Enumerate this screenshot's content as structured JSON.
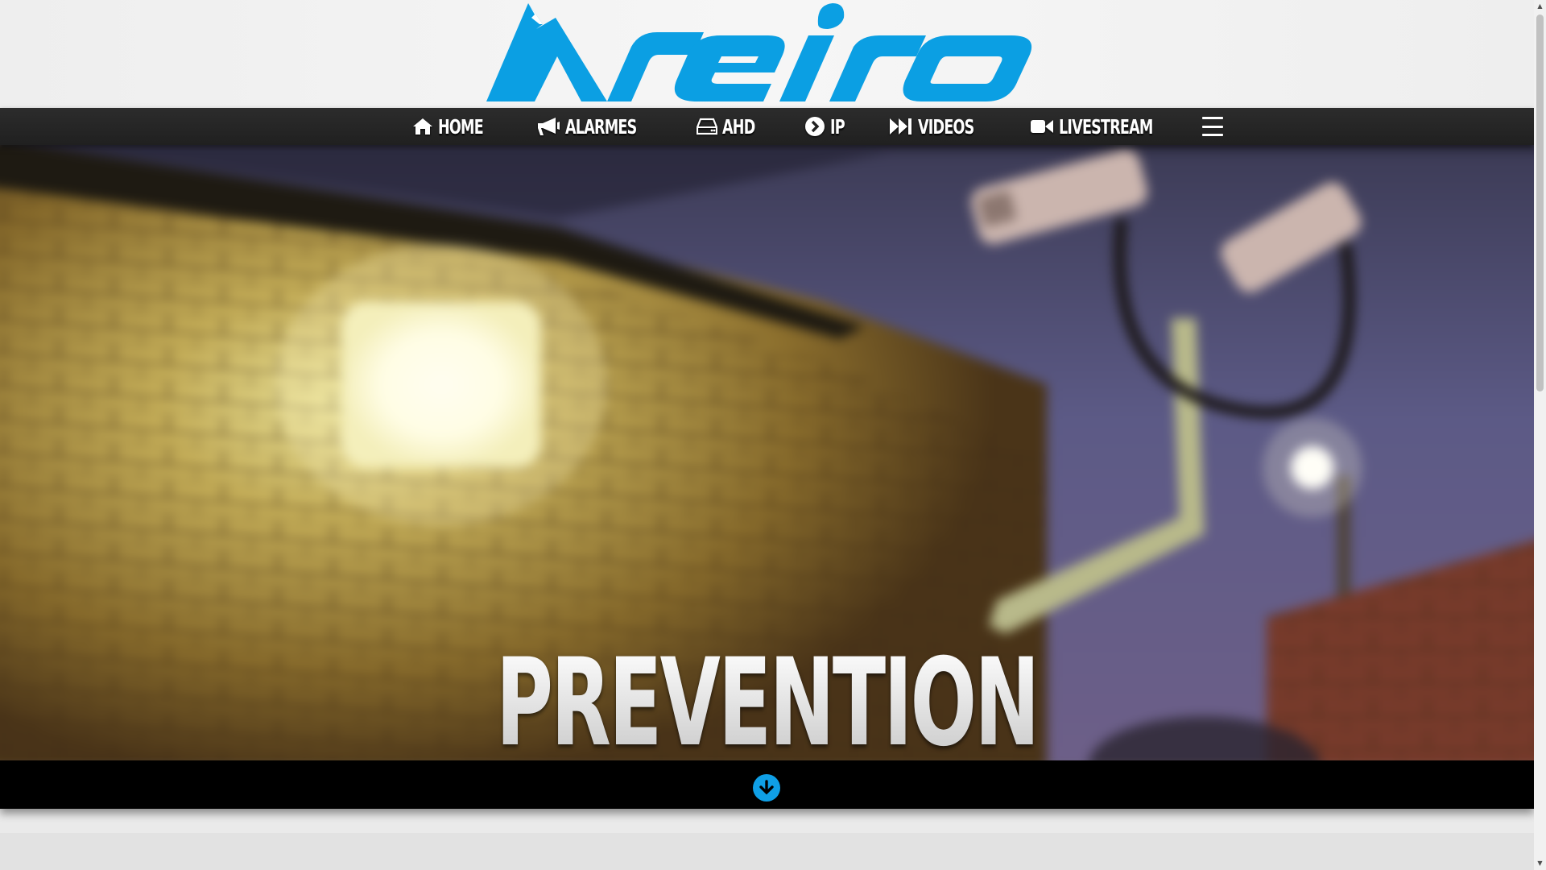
{
  "brand": {
    "logo_text": "areiro",
    "color": "#0b9fe3"
  },
  "nav": {
    "items": [
      {
        "label": "HOME",
        "icon": "home-icon"
      },
      {
        "label": "ALARMES",
        "icon": "megaphone-icon"
      },
      {
        "label": "AHD",
        "icon": "hard-drive-icon"
      },
      {
        "label": "IP",
        "icon": "chevron-circle-right-icon"
      },
      {
        "label": "VIDEOS",
        "icon": "fast-forward-icon"
      },
      {
        "label": "LIVESTREAM",
        "icon": "video-camera-icon"
      }
    ],
    "menu_icon": "hamburger-menu-icon"
  },
  "hero": {
    "title": "PREVENTION",
    "scroll_icon": "arrow-down-circle-icon",
    "accent": "#0f9fe6"
  },
  "scrollbar": {
    "up_glyph": "▲",
    "down_glyph": "▼"
  }
}
